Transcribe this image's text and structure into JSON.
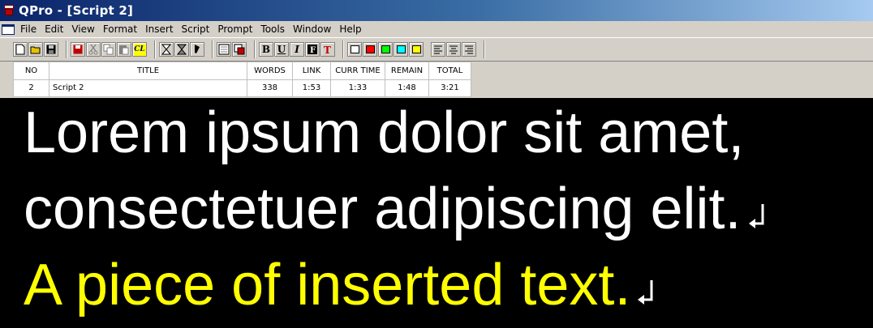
{
  "window": {
    "title": "QPro - [Script 2]"
  },
  "menu": [
    "File",
    "Edit",
    "View",
    "Format",
    "Insert",
    "Script",
    "Prompt",
    "Tools",
    "Window",
    "Help"
  ],
  "toolbar": {
    "bold_label": "B",
    "underline_label": "U",
    "italic_label": "I",
    "cl_label": "CL",
    "colors": [
      "#ffffff",
      "#ff0000",
      "#00ff00",
      "#00ffff",
      "#ffff00"
    ]
  },
  "stats": {
    "headers": {
      "no": "NO",
      "title": "TITLE",
      "words": "WORDS",
      "link": "LINK",
      "curr_time": "CURR TIME",
      "remain": "REMAIN",
      "total": "TOTAL"
    },
    "row": {
      "no": "2",
      "title": "Script 2",
      "words": "338",
      "link": "1:53",
      "curr_time": "1:33",
      "remain": "1:48",
      "total": "3:21"
    }
  },
  "prompt": {
    "line1": "Lorem ipsum dolor sit amet,",
    "line2": "consectetuer adipiscing elit.",
    "line3": "A piece of inserted text.",
    "text_color": "#ffffff",
    "inserted_color": "#ffff00",
    "background": "#000000"
  }
}
